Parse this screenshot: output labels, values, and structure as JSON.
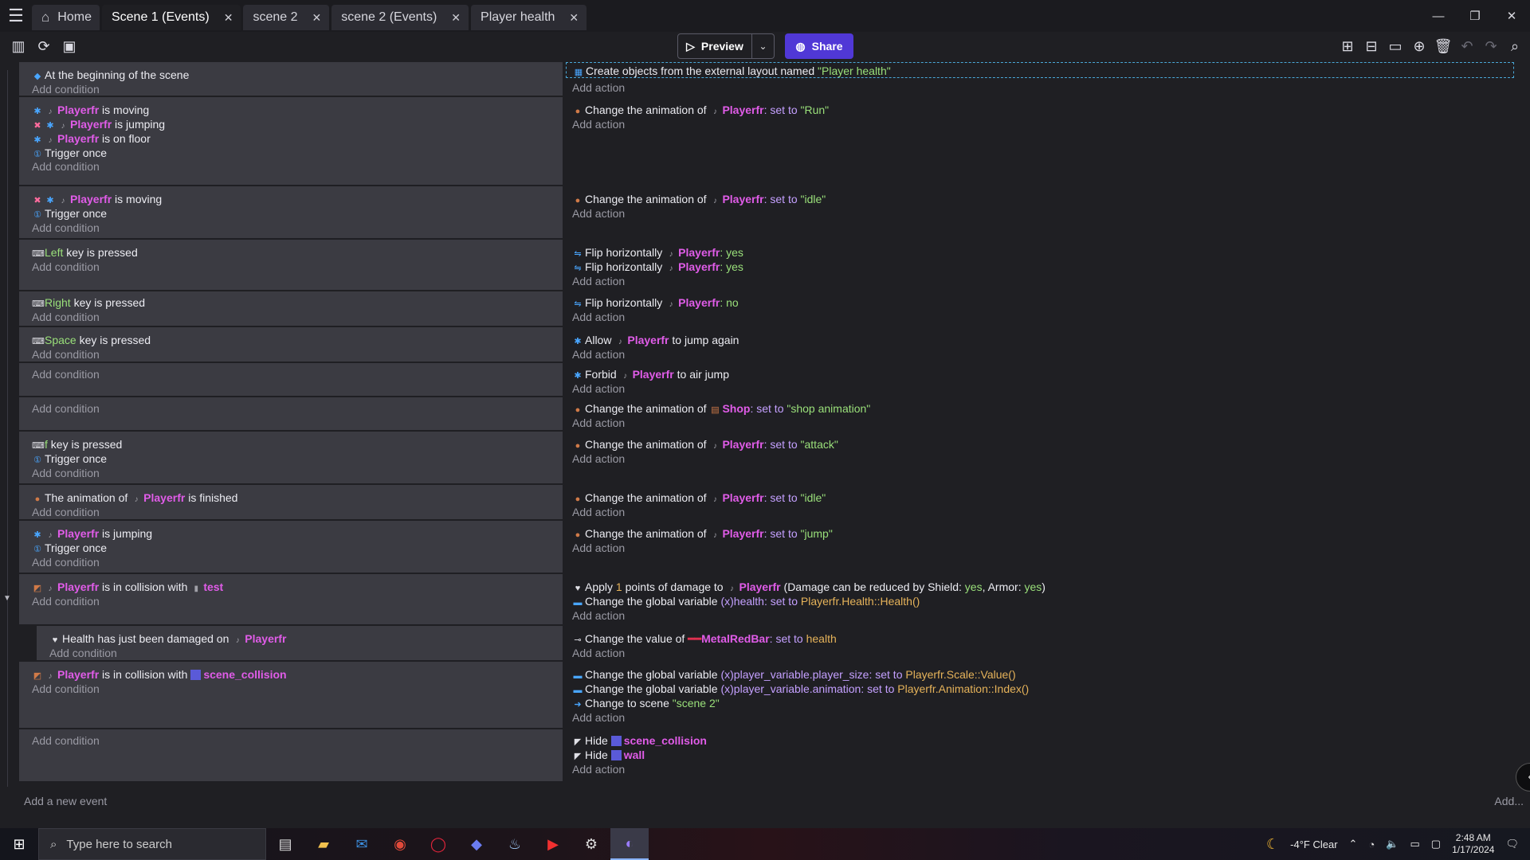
{
  "tabs": [
    {
      "label": "Home",
      "icon": "home-icon"
    },
    {
      "label": "Scene 1 (Events)",
      "active": true
    },
    {
      "label": "scene 2"
    },
    {
      "label": "scene 2 (Events)"
    },
    {
      "label": "Player health"
    }
  ],
  "toolbar": {
    "preview_label": "Preview",
    "share_label": "Share"
  },
  "common": {
    "add_condition": "Add condition",
    "add_action": "Add action"
  },
  "events": {
    "e1": {
      "c1": "At the beginning of the scene",
      "a1_text": "Create objects from the external layout named ",
      "a1_val": "\"Player health\""
    },
    "e2": {
      "c1_obj": "Playerfr",
      "c1_text": " is moving",
      "c2_obj": "Playerfr",
      "c2_text": " is jumping",
      "c3_obj": "Playerfr",
      "c3_text": " is on floor",
      "c4": "Trigger once",
      "a1_text": "Change the animation of ",
      "a1_obj": "Playerfr",
      "a1_kw": ": set to ",
      "a1_val": "\"Run\""
    },
    "e3": {
      "c1_obj": "Playerfr",
      "c1_text": " is moving",
      "c2": "Trigger once",
      "a1_text": "Change the animation of ",
      "a1_obj": "Playerfr",
      "a1_kw": ": set to ",
      "a1_val": "\"idle\""
    },
    "e4": {
      "c1_key": "Left",
      "c1_text": " key is pressed",
      "a1_text": "Flip horizontally ",
      "a1_obj": "Playerfr",
      "a1_val": ": yes",
      "a2_text": "Flip horizontally ",
      "a2_obj": "Playerfr",
      "a2_val": ": yes"
    },
    "e5": {
      "c1_key": "Right",
      "c1_text": " key is pressed",
      "a1_text": "Flip horizontally ",
      "a1_obj": "Playerfr",
      "a1_val": ": no"
    },
    "e6": {
      "c1_key": "Space",
      "c1_text": " key is pressed",
      "a1_text": "Allow ",
      "a1_obj": "Playerfr",
      "a1_text2": " to jump again"
    },
    "e7": {
      "a1_text": "Forbid ",
      "a1_obj": "Playerfr",
      "a1_text2": " to air jump"
    },
    "e8": {
      "a1_text": "Change the animation of ",
      "a1_obj": "Shop",
      "a1_kw": ": set to ",
      "a1_val": "\"shop animation\""
    },
    "e9": {
      "c1_key": "f",
      "c1_text": " key is pressed",
      "c2": "Trigger once",
      "a1_text": "Change the animation of ",
      "a1_obj": "Playerfr",
      "a1_kw": ": set to ",
      "a1_val": "\"attack\""
    },
    "e10": {
      "c1_text": "The animation of ",
      "c1_obj": "Playerfr",
      "c1_text2": " is finished",
      "a1_text": "Change the animation of ",
      "a1_obj": "Playerfr",
      "a1_kw": ": set to ",
      "a1_val": "\"idle\""
    },
    "e11": {
      "c1_obj": "Playerfr",
      "c1_text": " is jumping",
      "c2": "Trigger once",
      "a1_text": "Change the animation of ",
      "a1_obj": "Playerfr",
      "a1_kw": ": set to ",
      "a1_val": "\"jump\""
    },
    "e12": {
      "c1_obj": "Playerfr",
      "c1_text": " is in collision with ",
      "c1_obj2": "test",
      "a1_text": "Apply ",
      "a1_num": "1",
      "a1_text2": " points of damage to ",
      "a1_obj": "Playerfr",
      "a1_text3": " (Damage can be reduced by Shield: ",
      "a1_val": "yes",
      "a1_text4": ", Armor: ",
      "a1_val2": "yes",
      "a1_text5": ")",
      "a2_text": "Change the global variable ",
      "a2_var": "health",
      "a2_kw": ": set to ",
      "a2_val": "Playerfr.Health::Health()"
    },
    "e13": {
      "c1_text": "Health has just been damaged on ",
      "c1_obj": "Playerfr",
      "a1_text": "Change the value of ",
      "a1_obj": "MetalRedBar",
      "a1_kw": ": set to ",
      "a1_val": "health"
    },
    "e14": {
      "c1_obj": "Playerfr",
      "c1_text": " is in collision with ",
      "c1_obj2": "scene_collision",
      "a1_text": "Change the global variable ",
      "a1_var": "player_variable.player_size",
      "a1_kw": ": set to ",
      "a1_val": "Playerfr.Scale::Value()",
      "a2_text": "Change the global variable ",
      "a2_var": "player_variable.animation",
      "a2_kw": ": set to ",
      "a2_val": "Playerfr.Animation::Index()",
      "a3_text": "Change to scene ",
      "a3_val": "\"scene 2\""
    },
    "e15": {
      "a1_text": "Hide ",
      "a1_obj": "scene_collision",
      "a2_text": "Hide ",
      "a2_obj": "wall"
    }
  },
  "footer": {
    "add_event": "Add a new event",
    "add_right": "Add..."
  },
  "taskbar": {
    "search_placeholder": "Type here to search",
    "weather": "-4°F  Clear",
    "time": "2:48 AM",
    "date": "1/17/2024"
  }
}
